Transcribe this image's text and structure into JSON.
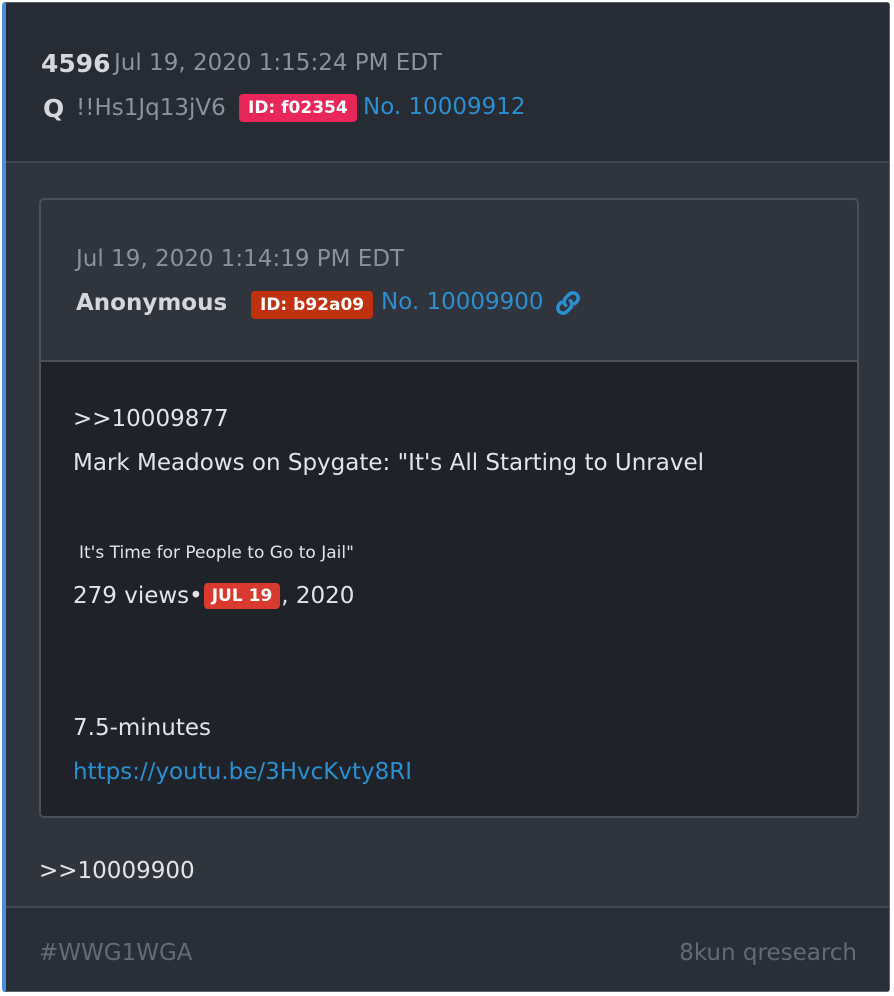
{
  "post": {
    "number": "4596",
    "date": "Jul 19, 2020 1:15:24 PM EDT",
    "author": "Q",
    "tripcode": "!!Hs1Jq13jV6",
    "id_label": "ID: f02354",
    "id_color": "#e8265a",
    "post_link": "No. 10009912"
  },
  "quoted": {
    "date": "Jul 19, 2020 1:14:19 PM EDT",
    "author": "Anonymous",
    "id_label": "ID: b92a09",
    "id_color": "#c0310f",
    "post_link": "No. 10009900",
    "link_icon": "chain-link-icon",
    "body": {
      "reply_ref": ">>10009877",
      "headline": "Mark Meadows on Spygate: \"It's All Starting to Unravel",
      "subline": "It's Time for People to Go to Jail\"",
      "views_prefix": "279 views•",
      "date_badge": "JUL 19",
      "views_suffix": ", 2020",
      "duration": "7.5-minutes",
      "url": "https://youtu.be/3HvcKvty8RI"
    }
  },
  "reply_ref": ">>10009900",
  "footer": {
    "hashtag": "#WWG1WGA",
    "source": "8kun qresearch"
  }
}
